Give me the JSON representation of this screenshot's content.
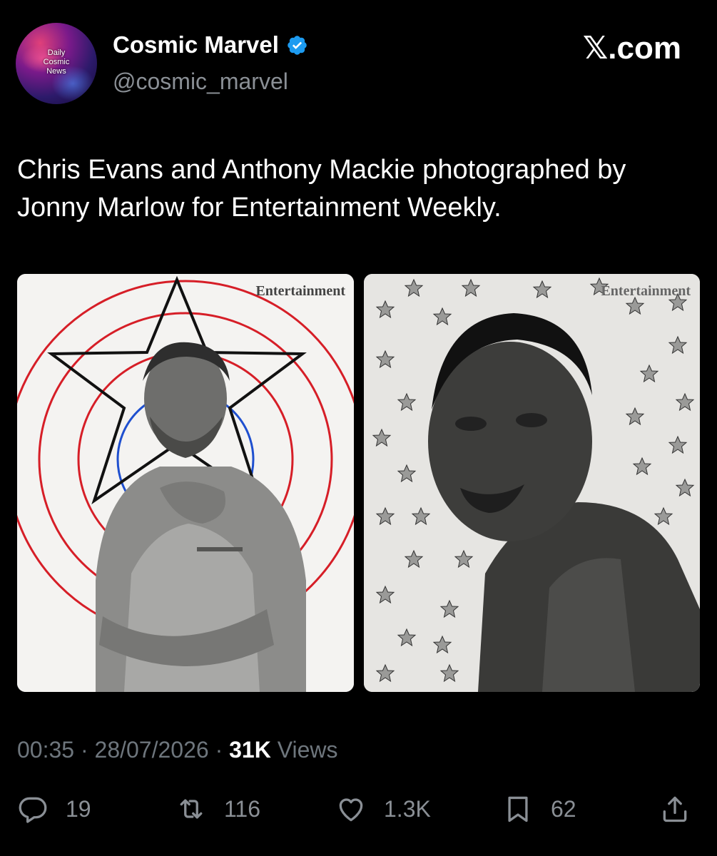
{
  "author": {
    "avatar_text": "Daily\nCosmic\nNews",
    "display_name": "Cosmic Marvel",
    "handle": "@cosmic_marvel",
    "verified_icon": "verified-badge-icon",
    "verified_color": "#1d9bf0"
  },
  "brand": {
    "x_glyph": "𝕏",
    "label": ".com"
  },
  "tweet": {
    "text": "Chris Evans and Anthony Mackie photographed by Jonny Marlow for Entertainment Weekly."
  },
  "media": [
    {
      "watermark": "Entertainment"
    },
    {
      "watermark": "Entertainment"
    }
  ],
  "meta": {
    "time": "00:35",
    "sep1": " · ",
    "date": "28/07/2026",
    "sep2": " · ",
    "views_count": "31K",
    "views_label": " Views"
  },
  "actions": {
    "reply": {
      "icon": "reply-icon",
      "count": "19"
    },
    "repost": {
      "icon": "repost-icon",
      "count": "116"
    },
    "like": {
      "icon": "like-icon",
      "count": "1.3K"
    },
    "bookmark": {
      "icon": "bookmark-icon",
      "count": "62"
    },
    "share": {
      "icon": "share-icon"
    }
  }
}
